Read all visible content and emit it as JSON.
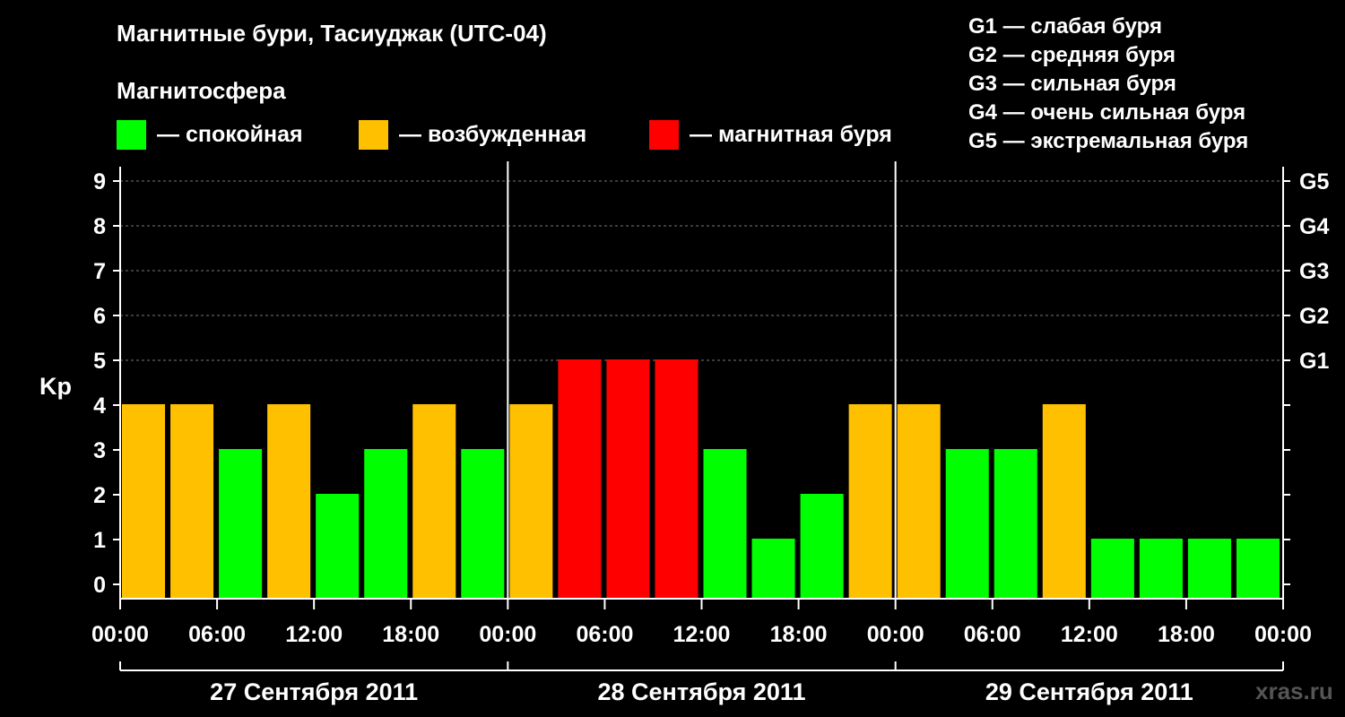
{
  "header": {
    "title": "Магнитные бури, Тасиуджак (UTC-04)",
    "subtitle": "Магнитосфера"
  },
  "legend": [
    {
      "label": "— спокойная",
      "color": "#00ff00"
    },
    {
      "label": "— возбужденная",
      "color": "#ffc000"
    },
    {
      "label": "— магнитная буря",
      "color": "#ff0000"
    }
  ],
  "storm_levels": [
    "G1 — слабая буря",
    "G2 — средняя буря",
    "G3 — сильная буря",
    "G4 — очень сильная буря",
    "G5 — экстремальная буря"
  ],
  "watermark": "xras.ru",
  "chart_data": {
    "type": "bar",
    "ylabel": "Kp",
    "ylim": [
      0,
      9
    ],
    "yticks": [
      0,
      1,
      2,
      3,
      4,
      5,
      6,
      7,
      8,
      9
    ],
    "right_ticks": [
      {
        "value": 5,
        "label": "G1"
      },
      {
        "value": 6,
        "label": "G2"
      },
      {
        "value": 7,
        "label": "G3"
      },
      {
        "value": 8,
        "label": "G4"
      },
      {
        "value": 9,
        "label": "G5"
      }
    ],
    "xtick_labels": [
      "00:00",
      "06:00",
      "12:00",
      "18:00",
      "00:00",
      "06:00",
      "12:00",
      "18:00",
      "00:00",
      "06:00",
      "12:00",
      "18:00",
      "00:00"
    ],
    "days": [
      "27 Сентября 2011",
      "28 Сентября 2011",
      "29 Сентября 2011"
    ],
    "values": [
      4,
      4,
      3,
      4,
      2,
      3,
      4,
      3,
      4,
      5,
      5,
      5,
      3,
      1,
      2,
      4,
      4,
      3,
      3,
      4,
      1,
      1,
      1,
      1
    ],
    "color_rule": {
      "quiet_max": 3,
      "unsettled": 4,
      "storm_min": 5
    },
    "colors": {
      "quiet": "#00ff00",
      "unsettled": "#ffc000",
      "storm": "#ff0000"
    },
    "grid": "dashed horizontal"
  }
}
